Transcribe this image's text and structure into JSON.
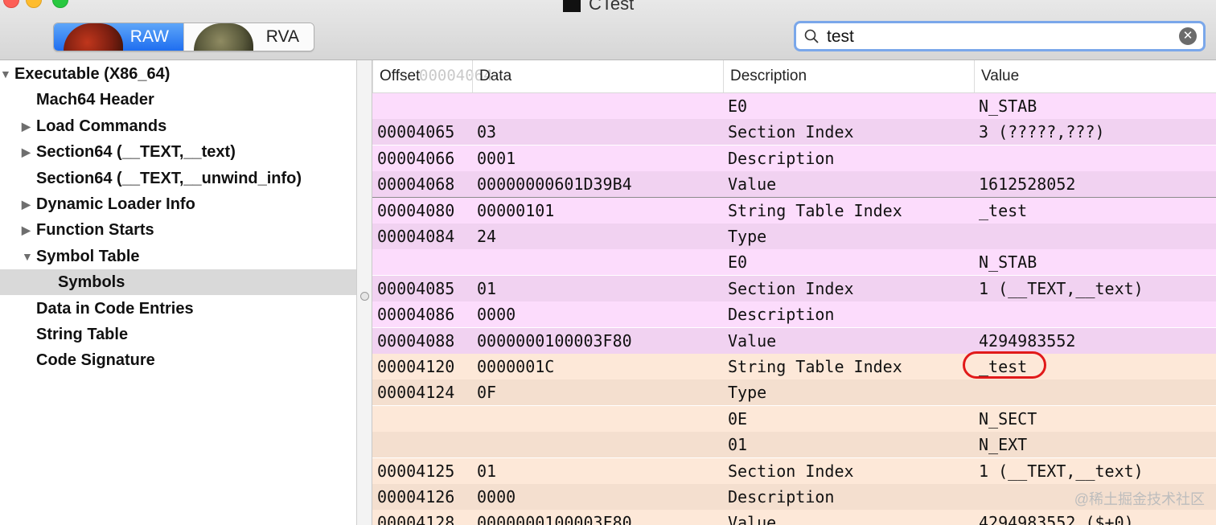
{
  "window": {
    "title": "CTest"
  },
  "toolbar": {
    "mode_raw_label": "RAW",
    "mode_rva_label": "RVA",
    "search_value": "test",
    "clear_symbol": "✕"
  },
  "sidebar": {
    "items": [
      {
        "label": "Executable  (X86_64)",
        "disclosure": "expanded"
      },
      {
        "label": "Mach64 Header",
        "disclosure": "none"
      },
      {
        "label": "Load Commands",
        "disclosure": "collapsed"
      },
      {
        "label": "Section64 (__TEXT,__text)",
        "disclosure": "collapsed"
      },
      {
        "label": "Section64 (__TEXT,__unwind_info)",
        "disclosure": "none"
      },
      {
        "label": "Dynamic Loader Info",
        "disclosure": "collapsed"
      },
      {
        "label": "Function Starts",
        "disclosure": "collapsed"
      },
      {
        "label": "Symbol Table",
        "disclosure": "expanded"
      },
      {
        "label": "Symbols",
        "disclosure": "none",
        "selected": true
      },
      {
        "label": "Data in Code Entries",
        "disclosure": "none"
      },
      {
        "label": "String Table",
        "disclosure": "none"
      },
      {
        "label": "Code Signature",
        "disclosure": "none"
      }
    ]
  },
  "table": {
    "columns": [
      "Offset",
      "Data",
      "Description",
      "Value"
    ],
    "ghost_text": "00004064",
    "rows": [
      {
        "offset": "",
        "data": "",
        "desc": "E0",
        "value": "N_STAB",
        "group": "stab"
      },
      {
        "offset": "00004065",
        "data": "03",
        "desc": "Section Index",
        "value": "3 (?????,???)",
        "group": "stab"
      },
      {
        "offset": "00004066",
        "data": "0001",
        "desc": "Description",
        "value": "",
        "group": "stab"
      },
      {
        "offset": "00004068",
        "data": "00000000601D39B4",
        "desc": "Value",
        "value": "1612528052",
        "group": "stab"
      },
      {
        "offset": "00004080",
        "data": "00000101",
        "desc": "String Table Index",
        "value": "_test",
        "group": "stab"
      },
      {
        "offset": "00004084",
        "data": "24",
        "desc": "Type",
        "value": "",
        "group": "stab"
      },
      {
        "offset": "",
        "data": "",
        "desc": "E0",
        "value": "N_STAB",
        "group": "stab"
      },
      {
        "offset": "00004085",
        "data": "01",
        "desc": "Section Index",
        "value": "1 (__TEXT,__text)",
        "group": "stab"
      },
      {
        "offset": "00004086",
        "data": "0000",
        "desc": "Description",
        "value": "",
        "group": "stab"
      },
      {
        "offset": "00004088",
        "data": "0000000100003F80",
        "desc": "Value",
        "value": "4294983552",
        "group": "stab"
      },
      {
        "offset": "00004120",
        "data": "0000001C",
        "desc": "String Table Index",
        "value": "_test",
        "group": "sect"
      },
      {
        "offset": "00004124",
        "data": "0F",
        "desc": "Type",
        "value": "",
        "group": "sect"
      },
      {
        "offset": "",
        "data": "",
        "desc": "0E",
        "value": "N_SECT",
        "group": "sect"
      },
      {
        "offset": "",
        "data": "",
        "desc": "01",
        "value": "N_EXT",
        "group": "sect"
      },
      {
        "offset": "00004125",
        "data": "01",
        "desc": "Section Index",
        "value": "1 (__TEXT,__text)",
        "group": "sect"
      },
      {
        "offset": "00004126",
        "data": "0000",
        "desc": "Description",
        "value": "",
        "group": "sect"
      },
      {
        "offset": "00004128",
        "data": "0000000100003F80",
        "desc": "Value",
        "value": "4294983552 ($+0)",
        "group": "sect"
      }
    ]
  },
  "colors": {
    "stab_a": "#fcdcfc",
    "stab_b": "#f1d2f1",
    "sect_a": "#fde8d8",
    "sect_b": "#f4dfcf",
    "accent": "#1f6ef0",
    "highlight": "#e11a1a"
  },
  "watermark": "@稀土掘金技术社区"
}
